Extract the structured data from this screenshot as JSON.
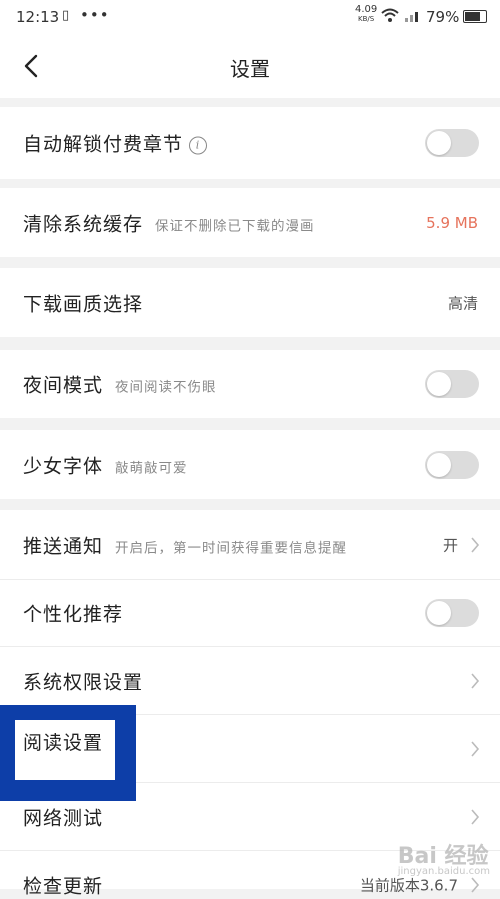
{
  "status_bar": {
    "time": "12:13",
    "net_speed_value": "4.09",
    "net_speed_unit": "KB/S",
    "battery": "79%",
    "battery_level": 0.79
  },
  "header": {
    "title": "设置"
  },
  "rows": {
    "auto_unlock": {
      "label": "自动解锁付费章节",
      "toggle": false
    },
    "clear_cache": {
      "label": "清除系统缓存",
      "sub": "保证不删除已下载的漫画",
      "value": "5.9 MB"
    },
    "download_quality": {
      "label": "下载画质选择",
      "value": "高清"
    },
    "night_mode": {
      "label": "夜间模式",
      "sub": "夜间阅读不伤眼",
      "toggle": false
    },
    "girl_font": {
      "label": "少女字体",
      "sub": "敲萌敲可爱",
      "toggle": false
    },
    "push": {
      "label": "推送通知",
      "sub": "开启后，第一时间获得重要信息提醒",
      "value": "开"
    },
    "personalized": {
      "label": "个性化推荐",
      "toggle": false
    },
    "permissions": {
      "label": "系统权限设置"
    },
    "reading": {
      "label": "阅读设置"
    },
    "network_test": {
      "label": "网络测试"
    },
    "check_update": {
      "label": "检查更新",
      "value": "当前版本3.6.7"
    }
  },
  "watermark": {
    "text": "Bai 经验",
    "sub": "jingyan.baidu.com"
  },
  "colors": {
    "accent_red": "#e6735c",
    "highlight_blue": "#0d3ea8"
  }
}
